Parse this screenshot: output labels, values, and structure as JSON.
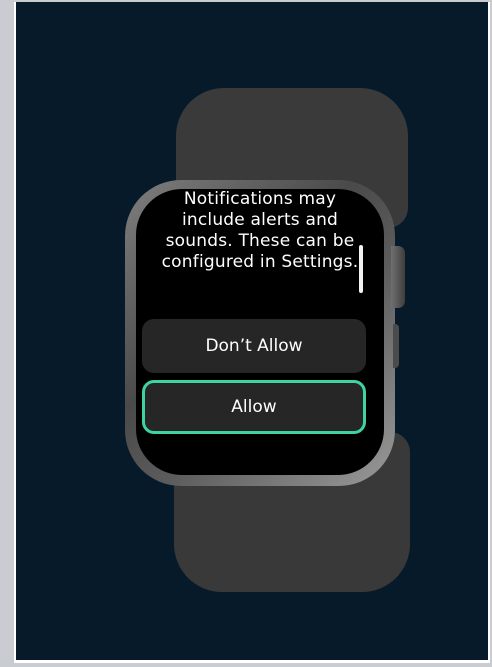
{
  "watch": {
    "message": "Notifications may include alerts and sounds. These can be configured in Settings.",
    "dont_allow_label": "Don’t Allow",
    "allow_label": "Allow"
  },
  "colors": {
    "background": "#061a2a",
    "focus_ring": "#3fd3a4",
    "button_fill": "#262626"
  }
}
